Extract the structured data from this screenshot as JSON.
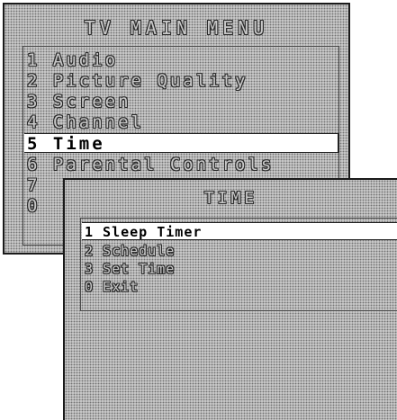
{
  "main_menu": {
    "title": "TV MAIN MENU",
    "items": [
      {
        "label": "1 Audio"
      },
      {
        "label": "2 Picture Quality"
      },
      {
        "label": "3 Screen"
      },
      {
        "label": "4 Channel"
      },
      {
        "label": "5 Time"
      },
      {
        "label": "6 Parental Controls"
      },
      {
        "label": "7"
      },
      {
        "label": "0"
      }
    ],
    "selected_index": 4
  },
  "time_menu": {
    "title": "TIME",
    "items": [
      {
        "label": "1 Sleep Timer"
      },
      {
        "label": "2 Schedule"
      },
      {
        "label": "3 Set Time"
      },
      {
        "label": "0 Exit"
      }
    ],
    "selected_index": 0
  }
}
